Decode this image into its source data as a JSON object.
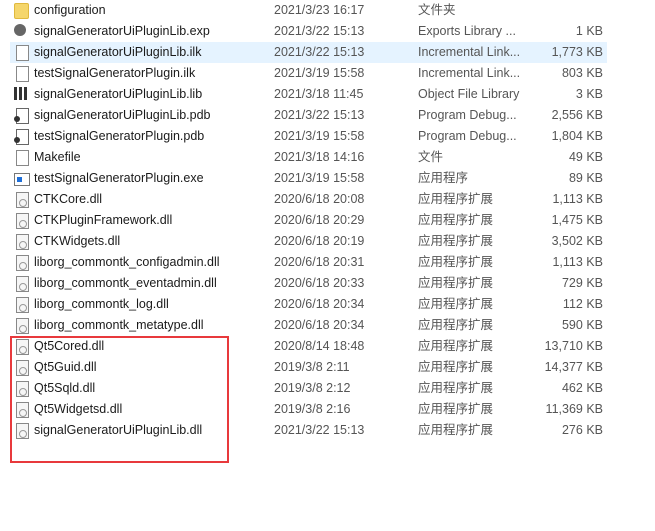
{
  "files": [
    {
      "name": "configuration",
      "date": "2021/3/23 16:17",
      "type": "文件夹",
      "size": "",
      "icon": "folder"
    },
    {
      "name": "signalGeneratorUiPluginLib.exp",
      "date": "2021/3/22 15:13",
      "type": "Exports Library ...",
      "size": "1 KB",
      "icon": "exp"
    },
    {
      "name": "signalGeneratorUiPluginLib.ilk",
      "date": "2021/3/22 15:13",
      "type": "Incremental Link...",
      "size": "1,773 KB",
      "icon": "file",
      "selected": true
    },
    {
      "name": "testSignalGeneratorPlugin.ilk",
      "date": "2021/3/19 15:58",
      "type": "Incremental Link...",
      "size": "803 KB",
      "icon": "file"
    },
    {
      "name": "signalGeneratorUiPluginLib.lib",
      "date": "2021/3/18 11:45",
      "type": "Object File Library",
      "size": "3 KB",
      "icon": "lib"
    },
    {
      "name": "signalGeneratorUiPluginLib.pdb",
      "date": "2021/3/22 15:13",
      "type": "Program Debug...",
      "size": "2,556 KB",
      "icon": "pdb"
    },
    {
      "name": "testSignalGeneratorPlugin.pdb",
      "date": "2021/3/19 15:58",
      "type": "Program Debug...",
      "size": "1,804 KB",
      "icon": "pdb"
    },
    {
      "name": "Makefile",
      "date": "2021/3/18 14:16",
      "type": "文件",
      "size": "49 KB",
      "icon": "file"
    },
    {
      "name": "testSignalGeneratorPlugin.exe",
      "date": "2021/3/19 15:58",
      "type": "应用程序",
      "size": "89 KB",
      "icon": "exe"
    },
    {
      "name": "CTKCore.dll",
      "date": "2020/6/18 20:08",
      "type": "应用程序扩展",
      "size": "1,113 KB",
      "icon": "dll"
    },
    {
      "name": "CTKPluginFramework.dll",
      "date": "2020/6/18 20:29",
      "type": "应用程序扩展",
      "size": "1,475 KB",
      "icon": "dll"
    },
    {
      "name": "CTKWidgets.dll",
      "date": "2020/6/18 20:19",
      "type": "应用程序扩展",
      "size": "3,502 KB",
      "icon": "dll"
    },
    {
      "name": "liborg_commontk_configadmin.dll",
      "date": "2020/6/18 20:31",
      "type": "应用程序扩展",
      "size": "1,113 KB",
      "icon": "dll"
    },
    {
      "name": "liborg_commontk_eventadmin.dll",
      "date": "2020/6/18 20:33",
      "type": "应用程序扩展",
      "size": "729 KB",
      "icon": "dll"
    },
    {
      "name": "liborg_commontk_log.dll",
      "date": "2020/6/18 20:34",
      "type": "应用程序扩展",
      "size": "112 KB",
      "icon": "dll"
    },
    {
      "name": "liborg_commontk_metatype.dll",
      "date": "2020/6/18 20:34",
      "type": "应用程序扩展",
      "size": "590 KB",
      "icon": "dll"
    },
    {
      "name": "Qt5Cored.dll",
      "date": "2020/8/14 18:48",
      "type": "应用程序扩展",
      "size": "13,710 KB",
      "icon": "dll"
    },
    {
      "name": "Qt5Guid.dll",
      "date": "2019/3/8 2:11",
      "type": "应用程序扩展",
      "size": "14,377 KB",
      "icon": "dll"
    },
    {
      "name": "Qt5Sqld.dll",
      "date": "2019/3/8 2:12",
      "type": "应用程序扩展",
      "size": "462 KB",
      "icon": "dll"
    },
    {
      "name": "Qt5Widgetsd.dll",
      "date": "2019/3/8 2:16",
      "type": "应用程序扩展",
      "size": "11,369 KB",
      "icon": "dll"
    },
    {
      "name": "signalGeneratorUiPluginLib.dll",
      "date": "2021/3/22 15:13",
      "type": "应用程序扩展",
      "size": "276 KB",
      "icon": "dll"
    }
  ],
  "highlight_color": "#e8393c"
}
